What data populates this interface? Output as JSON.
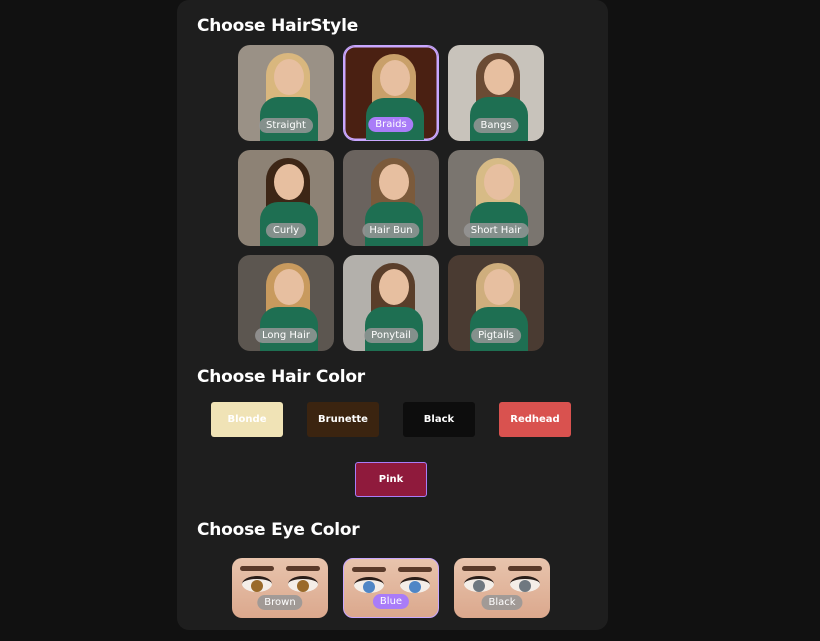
{
  "hairstyle_section": {
    "title": "Choose HairStyle",
    "options": [
      {
        "label": "Straight",
        "selected": false,
        "bg": "#9a9186",
        "hair": "#d9b77e"
      },
      {
        "label": "Braids",
        "selected": true,
        "bg": "#4a2012",
        "hair": "#c9a06a"
      },
      {
        "label": "Bangs",
        "selected": false,
        "bg": "#c8c3bb",
        "hair": "#6b4b34"
      },
      {
        "label": "Curly",
        "selected": false,
        "bg": "#8d8275",
        "hair": "#3d2616"
      },
      {
        "label": "Hair Bun",
        "selected": false,
        "bg": "#6a635e",
        "hair": "#7b5a3b"
      },
      {
        "label": "Short Hair",
        "selected": false,
        "bg": "#7a756f",
        "hair": "#d7bb86"
      },
      {
        "label": "Long Hair",
        "selected": false,
        "bg": "#5c5650",
        "hair": "#c89a5e"
      },
      {
        "label": "Ponytail",
        "selected": false,
        "bg": "#b3b0ab",
        "hair": "#5a3e2a"
      },
      {
        "label": "Pigtails",
        "selected": false,
        "bg": "#4a3b32",
        "hair": "#cfae7d"
      }
    ]
  },
  "hair_color_section": {
    "title": "Choose Hair Color",
    "options": [
      {
        "label": "Blonde",
        "color": "#f0e3b6",
        "text_color": "#ffffff",
        "selected": false
      },
      {
        "label": "Brunette",
        "color": "#3b2410",
        "text_color": "#ffffff",
        "selected": false
      },
      {
        "label": "Black",
        "color": "#0d0d0d",
        "text_color": "#ffffff",
        "selected": false
      },
      {
        "label": "Redhead",
        "color": "#d9524f",
        "text_color": "#ffffff",
        "selected": false
      },
      {
        "label": "Pink",
        "color": "#8f1a3c",
        "text_color": "#ffffff",
        "selected": true
      }
    ]
  },
  "eye_color_section": {
    "title": "Choose Eye Color",
    "options": [
      {
        "label": "Brown",
        "iris": "#9a6a2a",
        "selected": false
      },
      {
        "label": "Blue",
        "iris": "#4f86c6",
        "selected": true
      },
      {
        "label": "Black",
        "iris": "#6f7880",
        "selected": false
      }
    ]
  },
  "accent_color": "#a97cf8"
}
